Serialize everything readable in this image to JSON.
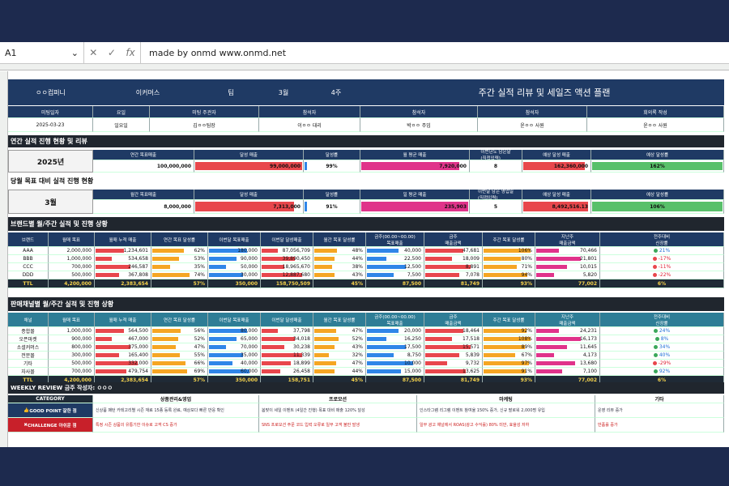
{
  "formula_bar": {
    "cell_ref": "A1",
    "content": "made by onmd www.onmd.net"
  },
  "header": {
    "company": "ㅇㅇ컴퍼니",
    "division": "이커머스",
    "team": "팀",
    "month": "3월",
    "week": "4주",
    "title": "주간 실적 리뷰 및 세일즈 액션 플랜"
  },
  "meta": {
    "labels": [
      "미팅일자",
      "요일",
      "미팅 주관자",
      "참석자",
      "참석자",
      "참석자",
      "회의록 작성"
    ],
    "values": [
      "2025-03-23",
      "일요일",
      "김ㅇㅇ팀장",
      "이ㅇㅇ 대리",
      "박ㅇㅇ 주임",
      "윤ㅇㅇ 사원",
      "윤ㅇㅇ 사원"
    ]
  },
  "annual": {
    "section": "연간 실적 진행 현황 및 리뷰",
    "year": "2025년",
    "headers": [
      "연간 목표매출",
      "달성 매출",
      "달성률",
      "월 평균 매출",
      "이번년도 남은달\n(직접입력)",
      "예상 달성 매출",
      "예상 달성률"
    ],
    "values": [
      "100,000,000",
      "99,000,000",
      "99%",
      "7,920,000",
      "8",
      "162,360,000",
      "162%"
    ],
    "fills": [
      0.99,
      0.99,
      0.05,
      0.9,
      0,
      0.9,
      1
    ]
  },
  "monthly": {
    "section": "당월 목표 대비 실적 진행 현황",
    "month": "3월",
    "headers": [
      "월간 목표매출",
      "달성 매출",
      "달성률",
      "일 평균 매출",
      "이번달 남은 영업일\n(직접입력)",
      "예상 달성 매출",
      "예상 달성률"
    ],
    "values": [
      "8,000,000",
      "7,313,000",
      "91%",
      "235,903",
      "5",
      "8,492,516.13",
      "106%"
    ],
    "fills": [
      0.91,
      0.91,
      0.05,
      1,
      0,
      0.95,
      1
    ]
  },
  "brand": {
    "section": "브랜드별 월/주간 실적 및 진행 상황",
    "headers": [
      "브랜드",
      "월매 목표",
      "월매 누적 매출",
      "연간 목표 달성률",
      "이번달 목표매출",
      "이번달 달성매출",
      "월간 목표 달성률",
      "금주(00.00~00.00)\n목표매출",
      "금주\n매출금액",
      "주간 목표 달성률",
      "지난주\n매출금액",
      "전주대비\n신장률"
    ],
    "rows": [
      [
        "AAA",
        "2,000,000",
        "1,234,601",
        "62%",
        "180,000",
        "87,056,709",
        "48%",
        "40,000",
        "47,681",
        "106%",
        "70,466",
        "21%"
      ],
      [
        "BBB",
        "1,000,000",
        "534,658",
        "53%",
        "90,000",
        "39,890,450",
        "44%",
        "22,500",
        "18,009",
        "80%",
        "21,801",
        "-17%"
      ],
      [
        "CCC",
        "700,000",
        "246,587",
        "35%",
        "50,000",
        "18,965,670",
        "38%",
        "12,500",
        "8,891",
        "71%",
        "10,015",
        "-11%"
      ],
      [
        "DDD",
        "500,000",
        "367,808",
        "74%",
        "30,000",
        "12,887,680",
        "43%",
        "7,500",
        "7,078",
        "94%",
        "5,820",
        "-22%"
      ]
    ],
    "total": [
      "TTL",
      "4,200,000",
      "2,383,654",
      "57%",
      "350,000",
      "158,750,509",
      "45%",
      "87,500",
      "81,749",
      "93%",
      "77,002",
      "6%"
    ]
  },
  "channel": {
    "section": "판매채널별 월/주간 실적 및 진행 상황",
    "headers": [
      "채널",
      "월매 목표",
      "월매 누적 매출",
      "연간 목표 달성률",
      "이번달 목표매출",
      "이번달 달성매출",
      "월간 목표 달성률",
      "금주(00.00~00.00)\n목표매출",
      "금주\n매출금액",
      "주간 목표 달성률",
      "지난주\n매출금액",
      "전주대비\n신장률"
    ],
    "rows": [
      [
        "종합몰",
        "1,000,000",
        "564,500",
        "56%",
        "80,000",
        "37,798",
        "47%",
        "20,000",
        "18,464",
        "92%",
        "24,231",
        "24%"
      ],
      [
        "오픈마켓",
        "900,000",
        "467,000",
        "52%",
        "65,000",
        "34,018",
        "52%",
        "16,250",
        "17,518",
        "108%",
        "16,173",
        "8%"
      ],
      [
        "소셜커머스",
        "800,000",
        "375,000",
        "47%",
        "70,000",
        "30,238",
        "43%",
        "17,500",
        "15,571",
        "89%",
        "11,645",
        "34%"
      ],
      [
        "전문몰",
        "300,000",
        "165,400",
        "55%",
        "35,000",
        "11,339",
        "32%",
        "8,750",
        "5,839",
        "67%",
        "4,173",
        "40%"
      ],
      [
        "기타",
        "500,000",
        "332,000",
        "66%",
        "40,000",
        "18,899",
        "47%",
        "10,000",
        "9,732",
        "97%",
        "13,680",
        "-29%"
      ],
      [
        "자사몰",
        "700,000",
        "479,754",
        "69%",
        "60,000",
        "26,458",
        "44%",
        "15,000",
        "13,625",
        "91%",
        "7,100",
        "92%"
      ]
    ],
    "total": [
      "TTL",
      "4,200,000",
      "2,383,654",
      "57%",
      "350,000",
      "158,751",
      "45%",
      "87,500",
      "81,749",
      "93%",
      "77,002",
      "6%"
    ]
  },
  "weekly": {
    "section": "WEEKLY REVIEW  금주 작성자: ㅇㅇㅇ",
    "headers": [
      "CATEGORY",
      "상품관리&영업",
      "프로모션",
      "마케팅",
      "기타"
    ],
    "good": {
      "label": "GOOD POINT 잘한 점",
      "cells": [
        "신상품 패턴 카테고리별 시즌 재료 15종 등록 완료, 예상보다 빠른 반응 확인",
        "봄맞이 세일 이벤트 (4일간 진행) 목표 대비 매출 120% 달성",
        "인스타그램 리그램 이벤트 참여율 150% 증가, 신규 팔로워 2,000명 유입",
        "운영 리뷰 증가"
      ]
    },
    "bad": {
      "label": "CHALLENGE 아쉬운 점",
      "cells": [
        "특정 시즌 상품의 유통기한 이슈로 고객 CS 증가",
        "SNS 프로모션 주문 코드 입력 오류로 일부 고객 불만 발생",
        "일부 광고 채널에서 ROAS(광고 수익률) 80% 미만, 효율성 저하",
        "반품률 증가"
      ]
    }
  },
  "colors": {
    "navy": "#1f3a64",
    "teal": "#2e7d96",
    "red": "#e8474c",
    "blue": "#2f86e8",
    "orange": "#f5a623",
    "pink": "#e0338a",
    "green": "#58c06a"
  }
}
